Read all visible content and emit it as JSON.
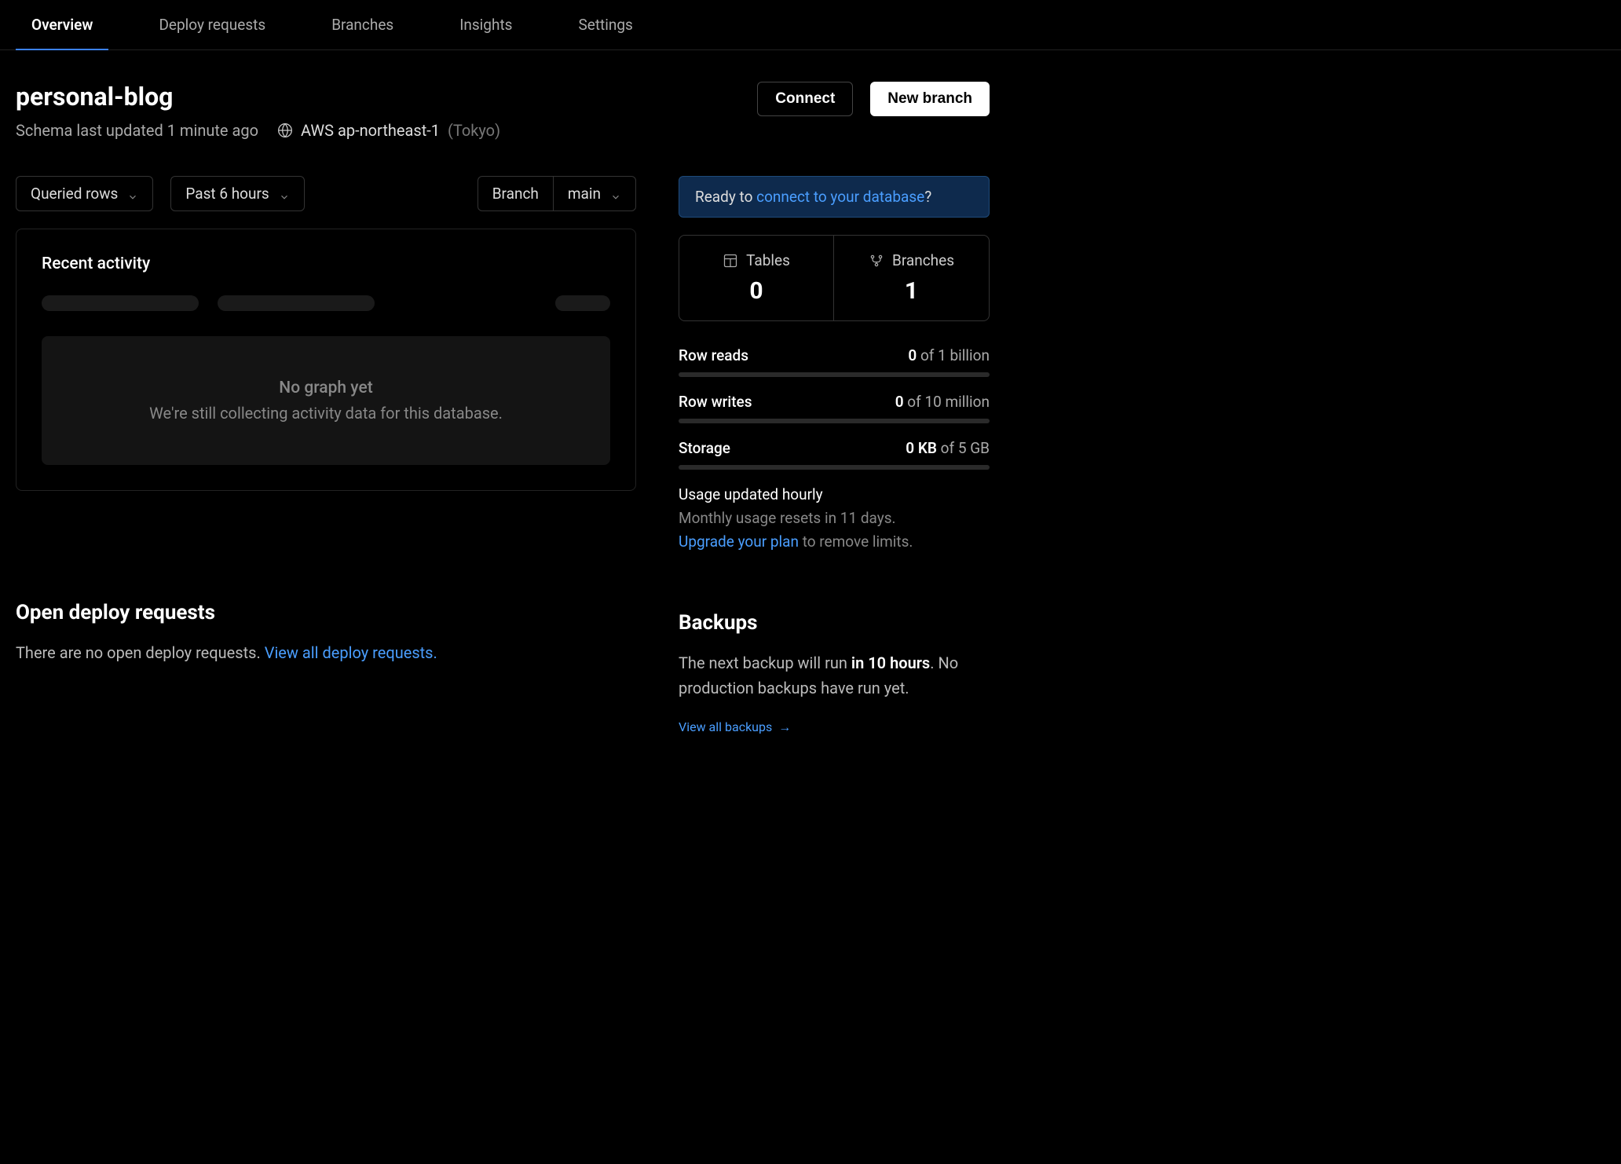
{
  "tabs": {
    "overview": "Overview",
    "deploy_requests": "Deploy requests",
    "branches": "Branches",
    "insights": "Insights",
    "settings": "Settings"
  },
  "header": {
    "title": "personal-blog",
    "schema_updated": "Schema last updated 1 minute ago",
    "region_provider": "AWS ap-northeast-1",
    "region_city": "(Tokyo)",
    "connect_label": "Connect",
    "new_branch_label": "New branch"
  },
  "controls": {
    "metric": "Queried rows",
    "timerange": "Past 6 hours",
    "branch_label": "Branch",
    "branch_value": "main"
  },
  "activity": {
    "title": "Recent activity",
    "no_graph_title": "No graph yet",
    "no_graph_sub": "We're still collecting activity data for this database."
  },
  "banner": {
    "prefix": "Ready to ",
    "link": "connect to your database",
    "suffix": "?"
  },
  "stats": {
    "tables_label": "Tables",
    "tables_value": "0",
    "branches_label": "Branches",
    "branches_value": "1"
  },
  "usage": {
    "row_reads": {
      "label": "Row reads",
      "value": "0",
      "limit": " of 1 billion"
    },
    "row_writes": {
      "label": "Row writes",
      "value": "0",
      "limit": " of 10 million"
    },
    "storage": {
      "label": "Storage",
      "value": "0 KB",
      "limit": " of 5 GB"
    },
    "note": "Usage updated hourly",
    "resets": "Monthly usage resets in 11 days.",
    "upgrade_link": "Upgrade your plan",
    "upgrade_suffix": " to remove limits."
  },
  "deploy_requests": {
    "title": "Open deploy requests",
    "empty": "There are no open deploy requests. ",
    "link": "View all deploy requests."
  },
  "backups": {
    "title": "Backups",
    "text_prefix": "The next backup will run ",
    "text_bold": "in 10 hours",
    "text_suffix": ". No production backups have run yet.",
    "link": "View all backups"
  }
}
